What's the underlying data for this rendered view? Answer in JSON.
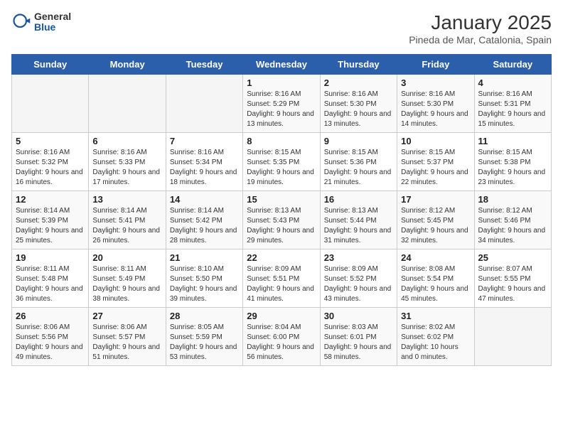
{
  "header": {
    "logo_general": "General",
    "logo_blue": "Blue",
    "title": "January 2025",
    "subtitle": "Pineda de Mar, Catalonia, Spain"
  },
  "weekdays": [
    "Sunday",
    "Monday",
    "Tuesday",
    "Wednesday",
    "Thursday",
    "Friday",
    "Saturday"
  ],
  "weeks": [
    [
      {
        "day": "",
        "info": ""
      },
      {
        "day": "",
        "info": ""
      },
      {
        "day": "",
        "info": ""
      },
      {
        "day": "1",
        "info": "Sunrise: 8:16 AM\nSunset: 5:29 PM\nDaylight: 9 hours\nand 13 minutes."
      },
      {
        "day": "2",
        "info": "Sunrise: 8:16 AM\nSunset: 5:30 PM\nDaylight: 9 hours\nand 13 minutes."
      },
      {
        "day": "3",
        "info": "Sunrise: 8:16 AM\nSunset: 5:30 PM\nDaylight: 9 hours\nand 14 minutes."
      },
      {
        "day": "4",
        "info": "Sunrise: 8:16 AM\nSunset: 5:31 PM\nDaylight: 9 hours\nand 15 minutes."
      }
    ],
    [
      {
        "day": "5",
        "info": "Sunrise: 8:16 AM\nSunset: 5:32 PM\nDaylight: 9 hours\nand 16 minutes."
      },
      {
        "day": "6",
        "info": "Sunrise: 8:16 AM\nSunset: 5:33 PM\nDaylight: 9 hours\nand 17 minutes."
      },
      {
        "day": "7",
        "info": "Sunrise: 8:16 AM\nSunset: 5:34 PM\nDaylight: 9 hours\nand 18 minutes."
      },
      {
        "day": "8",
        "info": "Sunrise: 8:15 AM\nSunset: 5:35 PM\nDaylight: 9 hours\nand 19 minutes."
      },
      {
        "day": "9",
        "info": "Sunrise: 8:15 AM\nSunset: 5:36 PM\nDaylight: 9 hours\nand 21 minutes."
      },
      {
        "day": "10",
        "info": "Sunrise: 8:15 AM\nSunset: 5:37 PM\nDaylight: 9 hours\nand 22 minutes."
      },
      {
        "day": "11",
        "info": "Sunrise: 8:15 AM\nSunset: 5:38 PM\nDaylight: 9 hours\nand 23 minutes."
      }
    ],
    [
      {
        "day": "12",
        "info": "Sunrise: 8:14 AM\nSunset: 5:39 PM\nDaylight: 9 hours\nand 25 minutes."
      },
      {
        "day": "13",
        "info": "Sunrise: 8:14 AM\nSunset: 5:41 PM\nDaylight: 9 hours\nand 26 minutes."
      },
      {
        "day": "14",
        "info": "Sunrise: 8:14 AM\nSunset: 5:42 PM\nDaylight: 9 hours\nand 28 minutes."
      },
      {
        "day": "15",
        "info": "Sunrise: 8:13 AM\nSunset: 5:43 PM\nDaylight: 9 hours\nand 29 minutes."
      },
      {
        "day": "16",
        "info": "Sunrise: 8:13 AM\nSunset: 5:44 PM\nDaylight: 9 hours\nand 31 minutes."
      },
      {
        "day": "17",
        "info": "Sunrise: 8:12 AM\nSunset: 5:45 PM\nDaylight: 9 hours\nand 32 minutes."
      },
      {
        "day": "18",
        "info": "Sunrise: 8:12 AM\nSunset: 5:46 PM\nDaylight: 9 hours\nand 34 minutes."
      }
    ],
    [
      {
        "day": "19",
        "info": "Sunrise: 8:11 AM\nSunset: 5:48 PM\nDaylight: 9 hours\nand 36 minutes."
      },
      {
        "day": "20",
        "info": "Sunrise: 8:11 AM\nSunset: 5:49 PM\nDaylight: 9 hours\nand 38 minutes."
      },
      {
        "day": "21",
        "info": "Sunrise: 8:10 AM\nSunset: 5:50 PM\nDaylight: 9 hours\nand 39 minutes."
      },
      {
        "day": "22",
        "info": "Sunrise: 8:09 AM\nSunset: 5:51 PM\nDaylight: 9 hours\nand 41 minutes."
      },
      {
        "day": "23",
        "info": "Sunrise: 8:09 AM\nSunset: 5:52 PM\nDaylight: 9 hours\nand 43 minutes."
      },
      {
        "day": "24",
        "info": "Sunrise: 8:08 AM\nSunset: 5:54 PM\nDaylight: 9 hours\nand 45 minutes."
      },
      {
        "day": "25",
        "info": "Sunrise: 8:07 AM\nSunset: 5:55 PM\nDaylight: 9 hours\nand 47 minutes."
      }
    ],
    [
      {
        "day": "26",
        "info": "Sunrise: 8:06 AM\nSunset: 5:56 PM\nDaylight: 9 hours\nand 49 minutes."
      },
      {
        "day": "27",
        "info": "Sunrise: 8:06 AM\nSunset: 5:57 PM\nDaylight: 9 hours\nand 51 minutes."
      },
      {
        "day": "28",
        "info": "Sunrise: 8:05 AM\nSunset: 5:59 PM\nDaylight: 9 hours\nand 53 minutes."
      },
      {
        "day": "29",
        "info": "Sunrise: 8:04 AM\nSunset: 6:00 PM\nDaylight: 9 hours\nand 56 minutes."
      },
      {
        "day": "30",
        "info": "Sunrise: 8:03 AM\nSunset: 6:01 PM\nDaylight: 9 hours\nand 58 minutes."
      },
      {
        "day": "31",
        "info": "Sunrise: 8:02 AM\nSunset: 6:02 PM\nDaylight: 10 hours\nand 0 minutes."
      },
      {
        "day": "",
        "info": ""
      }
    ]
  ]
}
